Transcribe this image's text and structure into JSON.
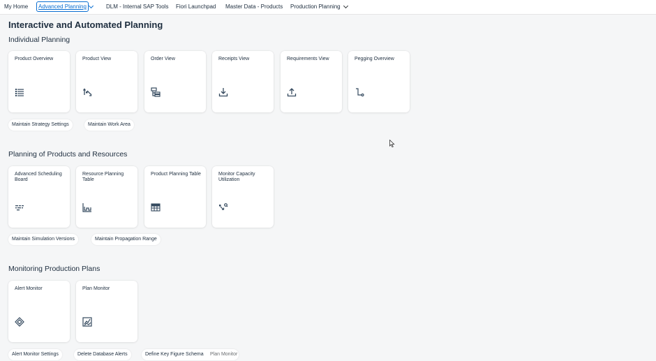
{
  "nav": {
    "tabs": [
      {
        "label": "My Home"
      },
      {
        "label": "Advanced Planning"
      },
      {
        "label": "DLM - Internal SAP Tools"
      },
      {
        "label": "Fiori Launchpad"
      },
      {
        "label": "Master Data - Products"
      },
      {
        "label": "Production Planning"
      }
    ]
  },
  "page": {
    "title": "Interactive and Automated Planning"
  },
  "sections": [
    {
      "title": "Individual Planning",
      "tiles": [
        {
          "title": "Product Overview",
          "icon": "list-icon"
        },
        {
          "title": "Product View",
          "icon": "sort-arrows-icon"
        },
        {
          "title": "Order View",
          "icon": "hierarchy-icon"
        },
        {
          "title": "Receipts View",
          "icon": "download-icon"
        },
        {
          "title": "Requirements View",
          "icon": "upload-icon"
        },
        {
          "title": "Pegging Overview",
          "icon": "pegging-icon"
        }
      ],
      "links": [
        "Maintain Strategy Settings",
        "Maintain Work Area"
      ]
    },
    {
      "title": "Planning of Products and Resources",
      "tiles": [
        {
          "title": "Advanced Scheduling Board",
          "icon": "gantt-icon"
        },
        {
          "title": "Resource Planning Table",
          "icon": "capacity-chart-icon"
        },
        {
          "title": "Product Planning Table",
          "icon": "table-icon"
        },
        {
          "title": "Monitor Capacity Utilization",
          "icon": "capacity-monitor-icon"
        }
      ],
      "links": [
        "Maintain Simulation Versions",
        "Maintain Propagation Range"
      ]
    },
    {
      "title": "Monitoring Production Plans",
      "tiles": [
        {
          "title": "Alert Monitor",
          "icon": "alert-diamond-icon"
        },
        {
          "title": "Plan Monitor",
          "icon": "line-chart-icon"
        }
      ],
      "links": [
        "Alert Monitor Settings",
        "Delete Database Alerts",
        "Define Key Figure Schema"
      ],
      "tooltip": "Plan Monitor"
    }
  ],
  "colors": {
    "accent": "#0a6ed1",
    "background": "#f5f6f7",
    "tile": "#ffffff",
    "text": "#1d2d3e"
  }
}
